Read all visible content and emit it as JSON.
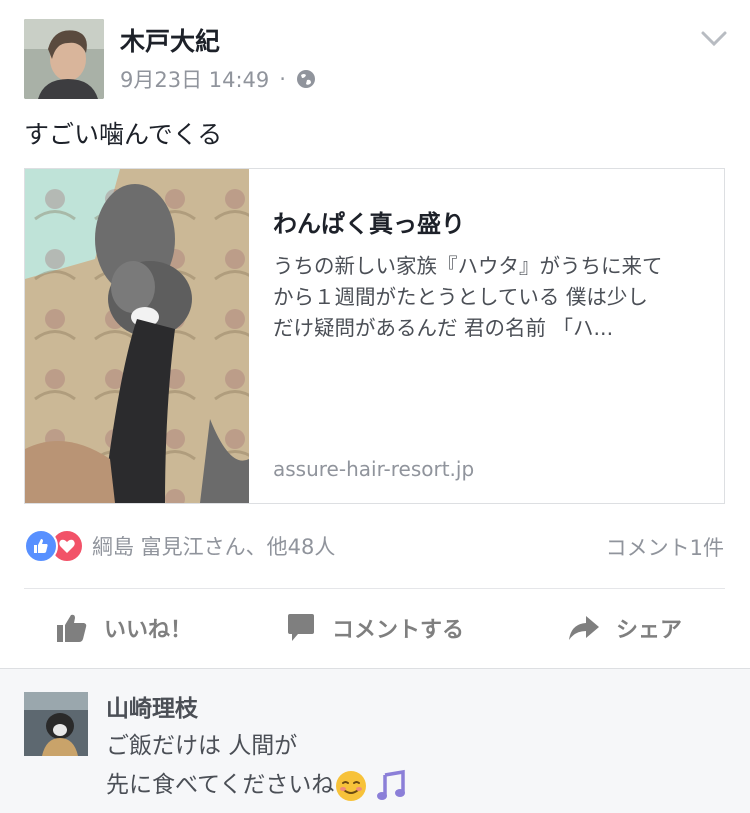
{
  "post": {
    "author": "木戸大紀",
    "timestamp": "9月23日 14:49",
    "separator": "·",
    "privacy_icon": "globe-icon",
    "text": "すごい噛んでくる"
  },
  "link_preview": {
    "title": "わんぱく真っ盛り",
    "description_lines": [
      "うちの新しい家族『ハウタ』がうちに来て",
      "から１週間がたとうとしている 僕は少し",
      "だけ疑問があるんだ 君の名前 「ハ..."
    ],
    "domain": "assure-hair-resort.jp"
  },
  "reactions": {
    "text": "綱島 富見江さん、他48人",
    "icons": [
      "like-reaction-icon",
      "love-reaction-icon"
    ],
    "comment_count": "コメント1件"
  },
  "actions": {
    "like": "いいね！",
    "comment": "コメントする",
    "share": "シェア"
  },
  "comment": {
    "author": "山崎理枝",
    "line1": "ご飯だけは 人間が",
    "line2": "先に食べてくださいね",
    "emojis": [
      "smiling-face-emoji",
      "music-notes-emoji"
    ]
  },
  "colors": {
    "like_blue": "#5890ff",
    "love_red": "#f25268",
    "meta_gray": "#90949c",
    "comment_bg": "#f6f7f9"
  }
}
